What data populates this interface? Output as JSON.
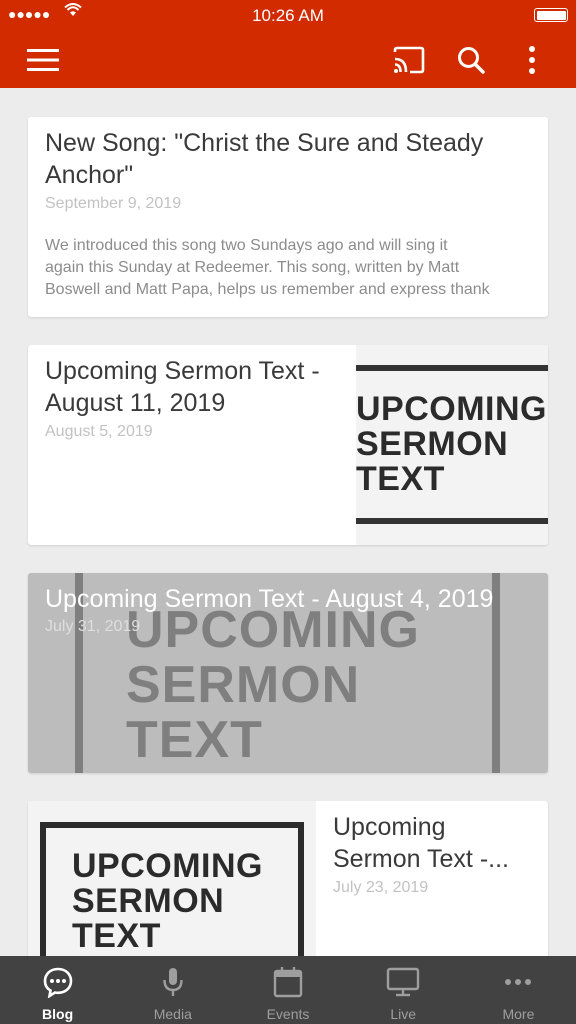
{
  "status_bar": {
    "signal": "●●●●●",
    "time": "10:26 AM",
    "battery_level": 1.0
  },
  "app_bar": {
    "color": "#d22b00",
    "icons": [
      "menu-icon",
      "cast-icon",
      "search-icon",
      "more-vert-icon"
    ]
  },
  "posts": [
    {
      "title": "New Song: \"Christ the Sure and Steady Anchor\"",
      "date": "September 9, 2019",
      "excerpt_lines": [
        "We introduced this song two Sundays ago and will sing it",
        "again this Sunday at Redeemer. This song, written by Matt",
        "Boswell and Matt Papa, helps us remember and express thank"
      ]
    },
    {
      "title": "Upcoming Sermon Text - August 11, 2019",
      "date": "August 5, 2019",
      "image_text": [
        "UPCOMING",
        "SERMON",
        "TEXT"
      ]
    },
    {
      "title": "Upcoming Sermon Text - August 4, 2019",
      "date": "July 31, 2019",
      "image_text": [
        "UPCOMING",
        "SERMON",
        "TEXT"
      ]
    },
    {
      "title": "Upcoming Sermon Text -...",
      "date": "July 23, 2019",
      "image_text": [
        "UPCOMING",
        "SERMON",
        "TEXT"
      ]
    }
  ],
  "bottom_nav": {
    "items": [
      {
        "label": "Blog",
        "icon": "chat-bubble-icon",
        "active": true
      },
      {
        "label": "Media",
        "icon": "microphone-icon",
        "active": false
      },
      {
        "label": "Events",
        "icon": "calendar-icon",
        "active": false
      },
      {
        "label": "Live",
        "icon": "monitor-icon",
        "active": false
      },
      {
        "label": "More",
        "icon": "more-horiz-icon",
        "active": false
      }
    ]
  }
}
